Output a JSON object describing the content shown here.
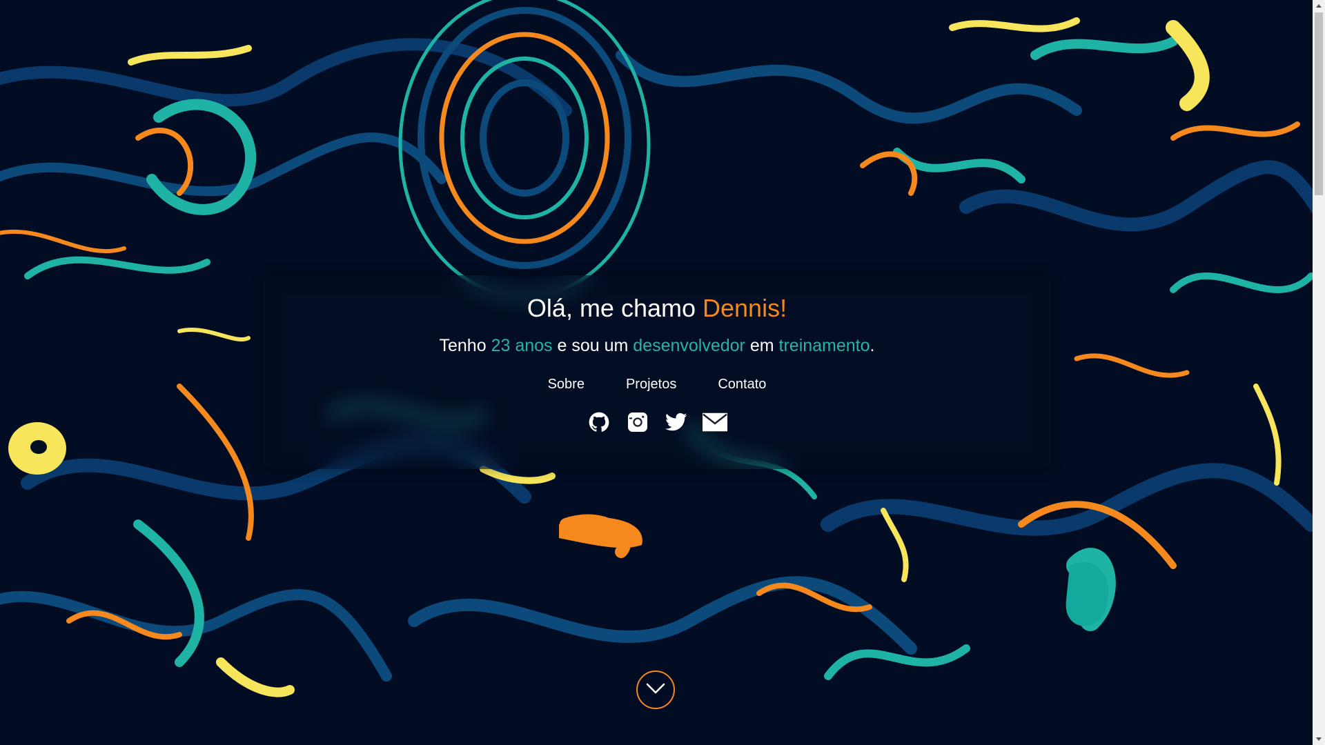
{
  "hero": {
    "title_prefix": "Olá, me chamo ",
    "title_name": "Dennis!",
    "sub_1": "Tenho ",
    "sub_age": "23 anos",
    "sub_2": " e sou um ",
    "sub_role": "desenvolvedor",
    "sub_3": " em ",
    "sub_status": "treinamento",
    "sub_4": "."
  },
  "nav": {
    "items": [
      "Sobre",
      "Projetos",
      "Contato"
    ]
  },
  "social": {
    "icons": [
      "github-icon",
      "instagram-icon",
      "twitter-icon",
      "mail-icon"
    ]
  },
  "colors": {
    "accent_orange": "#f5891e",
    "accent_teal": "#26b5a3",
    "background": "#020d24",
    "text": "#ffffff"
  },
  "scroll_down": {
    "icon": "chevron-down-icon"
  }
}
